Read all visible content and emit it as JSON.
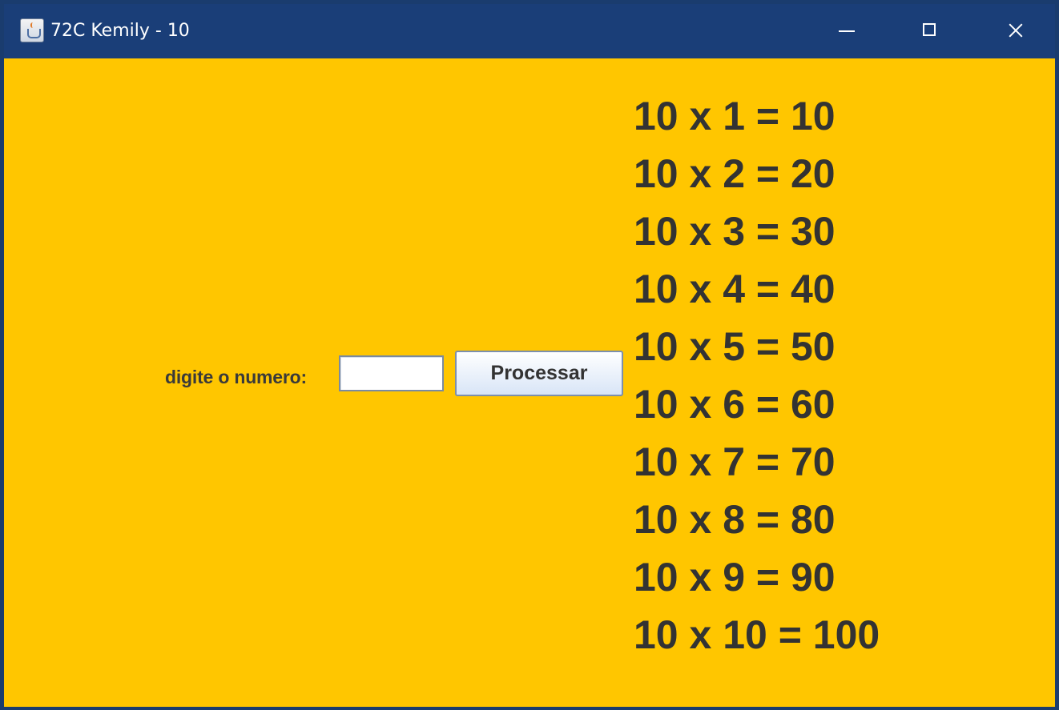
{
  "window": {
    "title": "72C Kemily - 10",
    "colors": {
      "titlebar": "#1a3e78",
      "background": "#ffc600",
      "text": "#333333"
    }
  },
  "form": {
    "prompt_label": "digite o numero:",
    "input_value": "",
    "button_label": "Processar"
  },
  "multiplication_table": [
    "10 x 1 = 10",
    "10 x 2 = 20",
    "10 x 3 = 30",
    "10 x 4 = 40",
    "10 x 5 = 50",
    "10 x 6 = 60",
    "10 x 7 = 70",
    "10 x 8 = 80",
    "10 x 9 = 90",
    "10 x 10 = 100"
  ],
  "icons": {
    "app": "java-app-icon",
    "minimize": "minimize-icon",
    "maximize": "maximize-icon",
    "close": "close-icon"
  }
}
